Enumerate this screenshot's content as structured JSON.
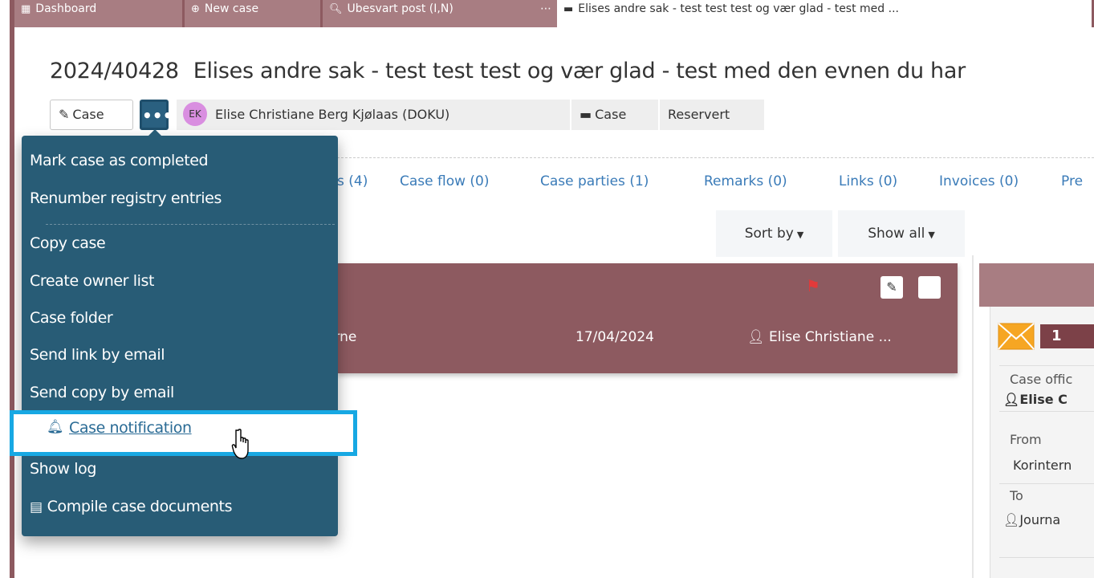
{
  "tabbar": {
    "tabs": [
      {
        "label": "Dashboard",
        "icon": "dashboard-icon"
      },
      {
        "label": "New case",
        "icon": "plus-circle-icon"
      },
      {
        "label": "Ubesvart post (I,N)",
        "icon": "search-icon"
      },
      {
        "label": "Elises andre sak - test test test og vær glad - test med ...",
        "icon": "folder-icon",
        "active": true
      }
    ]
  },
  "case": {
    "number": "2024/40428",
    "title": "Elises andre sak - test test test og vær glad - test med den evnen du har",
    "edit_label": "Case",
    "more_label": "•••",
    "owner_initials": "EK",
    "owner_name": "Elise Christiane Berg Kjølaas (DOKU)",
    "type_label": "Case",
    "status_label": "Reservert"
  },
  "subtabs": [
    "s (4)",
    "Case flow (0)",
    "Case parties (1)",
    "Remarks (0)",
    "Links (0)",
    "Invoices (0)",
    "Pre"
  ],
  "sort": {
    "sort_label": "Sort by",
    "show_label": "Show all"
  },
  "entry": {
    "from": "erne",
    "date": "17/04/2024",
    "user": "Elise Christiane ..."
  },
  "side_panel": {
    "badge": "1",
    "case_officer_label": "Case offic",
    "case_officer_value": "Elise C",
    "from_label": "From",
    "from_value": "Korintern",
    "to_label": "To",
    "to_value": "Journa"
  },
  "menu": {
    "items_top": [
      "Mark case as completed",
      "Renumber registry entries"
    ],
    "items_bottom": [
      "Copy case",
      "Create owner list",
      "Case folder",
      "Send link by email",
      "Send copy by email"
    ],
    "highlighted": "Case notification",
    "items_after": [
      "Show log"
    ],
    "compile": "Compile case documents"
  },
  "colors": {
    "brand": "#8d5a60",
    "menu_bg": "#285c76",
    "link": "#3a7bb8",
    "highlight": "#17a8e3"
  }
}
